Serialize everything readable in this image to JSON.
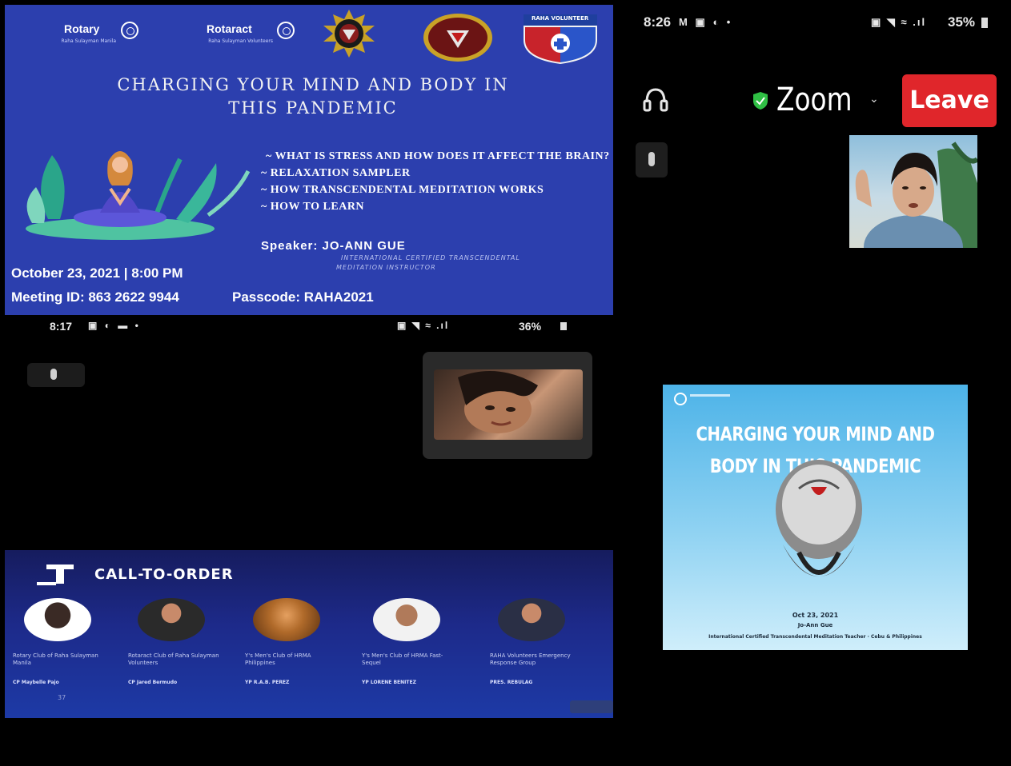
{
  "poster": {
    "logos": {
      "rotary": "Rotary",
      "rotary_sub": "Raha Sulayman Manila",
      "rotaract": "Rotaract",
      "rotaract_sub": "Raha Sulayman Volunteers",
      "volunteer_badge": "RAHA VOLUNTEER"
    },
    "title_line1": "CHARGING YOUR MIND AND BODY IN",
    "title_line2": "THIS PANDEMIC",
    "bullets": [
      "~ WHAT IS STRESS AND HOW DOES IT AFFECT THE BRAIN?",
      "~ RELAXATION SAMPLER",
      "~ HOW TRANSCENDENTAL MEDITATION WORKS",
      "~ HOW TO LEARN"
    ],
    "speaker": "Speaker: JO-ANN GUE",
    "speaker_credential_1": "INTERNATIONAL CERTIFIED TRANSCENDENTAL",
    "speaker_credential_2": "MEDITATION INSTRUCTOR",
    "date_time": "October 23, 2021 | 8:00 PM",
    "meeting_id": "Meeting ID: 863 2622 9944",
    "passcode": "Passcode: RAHA2021"
  },
  "left_phone": {
    "time": "8:17",
    "battery": "36%",
    "call_title": "CALL-TO-ORDER",
    "participants": [
      {
        "org": "Rotary Club of Raha Sulayman Manila",
        "name": "CP Maybelle Pajo"
      },
      {
        "org": "Rotaract Club of Raha Sulayman Volunteers",
        "name": "CP Jared Bermudo"
      },
      {
        "org": "Y's Men's Club of HRMA Philippines",
        "name": "YP R.A.B. PEREZ"
      },
      {
        "org": "Y's Men's Club of HRMA Fast-Sequel",
        "name": "YP LORENE BENITEZ"
      },
      {
        "org": "RAHA Volunteers Emergency Response Group",
        "name": "PRES. REBULAG"
      }
    ],
    "page_num": "37"
  },
  "right_phone": {
    "time": "8:26",
    "battery": "35%",
    "app_name": "Zoom",
    "leave_label": "Leave",
    "slide_title_1": "CHARGING YOUR MIND AND",
    "slide_title_2": "BODY IN THIS PANDEMIC",
    "slide_date": "Oct 23, 2021",
    "slide_speaker": "Jo-Ann Gue",
    "slide_footer": "International Certified Transcendental Meditation Teacher · Cebu & Philippines"
  },
  "colors": {
    "poster_bg": "#2c3fae",
    "leave_red": "#e0262b",
    "zoom_shield": "#2fbf44"
  }
}
